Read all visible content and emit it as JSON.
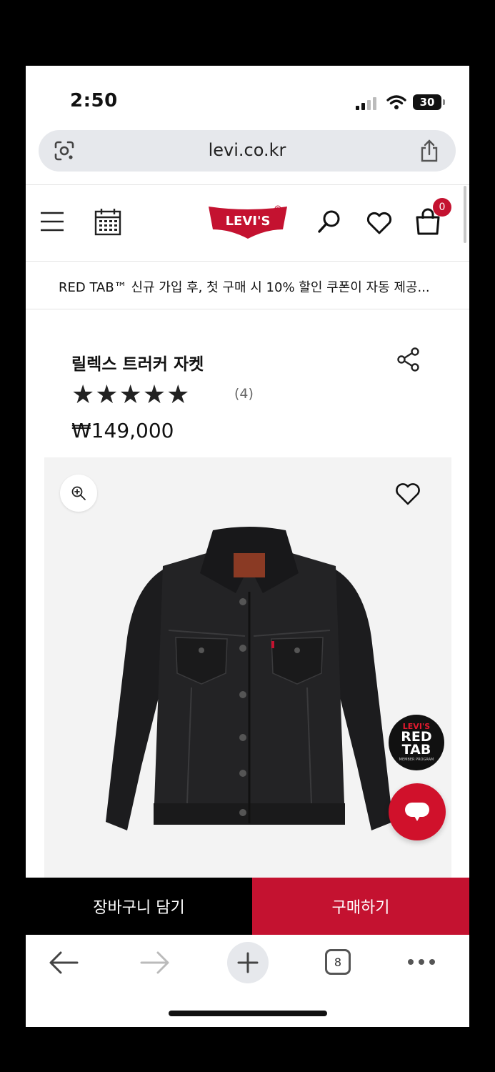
{
  "status_bar": {
    "time": "2:50",
    "battery": "30"
  },
  "browser": {
    "url": "levi.co.kr",
    "tab_count": "8"
  },
  "header": {
    "brand": "Levi's",
    "cart_count": "0"
  },
  "promo_banner": {
    "text": "RED TAB™ 신규 가입 후, 첫 구매 시 10% 할인 쿠폰이 자동 제공..."
  },
  "product": {
    "title": "릴렉스 트러커 자켓",
    "stars": "★★★★★",
    "rating": 5,
    "review_count": "(4)",
    "price": "₩149,000"
  },
  "badges": {
    "red_tab_line1": "LEVI'S",
    "red_tab_line2": "RED TAB",
    "red_tab_line3": "MEMBER PROGRAM"
  },
  "actions": {
    "add_to_cart": "장바구니 담기",
    "buy_now": "구매하기"
  },
  "colors": {
    "brand_red": "#c41230",
    "black": "#000000"
  }
}
